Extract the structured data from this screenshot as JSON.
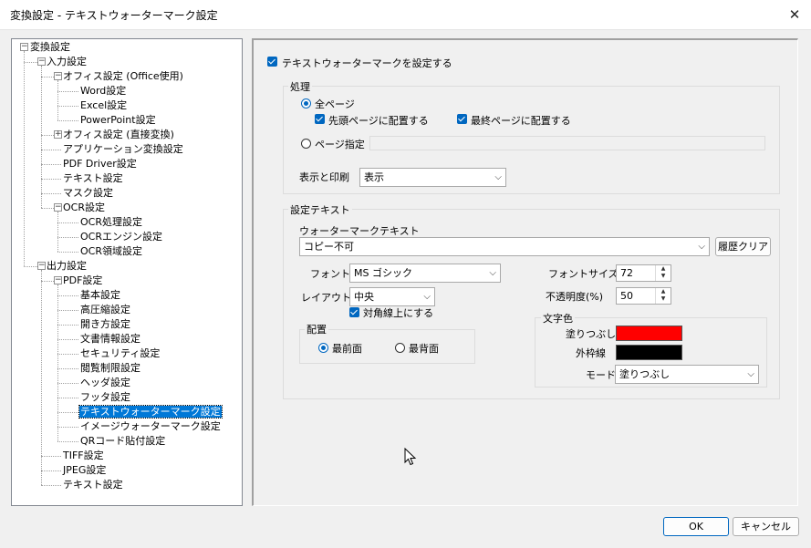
{
  "window": {
    "title": "変換設定 - テキストウォーターマーク設定"
  },
  "tree": {
    "nodes": [
      {
        "label": "変換設定",
        "level": 0,
        "expander": "minus"
      },
      {
        "label": "入力設定",
        "level": 1,
        "expander": "minus"
      },
      {
        "label": "オフィス設定 (Office使用)",
        "level": 2,
        "expander": "minus"
      },
      {
        "label": "Word設定",
        "level": 3
      },
      {
        "label": "Excel設定",
        "level": 3
      },
      {
        "label": "PowerPoint設定",
        "level": 3
      },
      {
        "label": "オフィス設定 (直接変換)",
        "level": 2,
        "expander": "plus"
      },
      {
        "label": "アプリケーション変換設定",
        "level": 2
      },
      {
        "label": "PDF Driver設定",
        "level": 2
      },
      {
        "label": "テキスト設定",
        "level": 2
      },
      {
        "label": "マスク設定",
        "level": 2
      },
      {
        "label": "OCR設定",
        "level": 2,
        "expander": "minus"
      },
      {
        "label": "OCR処理設定",
        "level": 3
      },
      {
        "label": "OCRエンジン設定",
        "level": 3
      },
      {
        "label": "OCR領域設定",
        "level": 3
      },
      {
        "label": "出力設定",
        "level": 1,
        "expander": "minus"
      },
      {
        "label": "PDF設定",
        "level": 2,
        "expander": "minus"
      },
      {
        "label": "基本設定",
        "level": 3
      },
      {
        "label": "高圧縮設定",
        "level": 3
      },
      {
        "label": "開き方設定",
        "level": 3
      },
      {
        "label": "文書情報設定",
        "level": 3
      },
      {
        "label": "セキュリティ設定",
        "level": 3
      },
      {
        "label": "閲覧制限設定",
        "level": 3
      },
      {
        "label": "ヘッダ設定",
        "level": 3
      },
      {
        "label": "フッタ設定",
        "level": 3
      },
      {
        "label": "テキストウォーターマーク設定",
        "level": 3,
        "selected": true
      },
      {
        "label": "イメージウォーターマーク設定",
        "level": 3
      },
      {
        "label": "QRコード貼付設定",
        "level": 3
      },
      {
        "label": "TIFF設定",
        "level": 2
      },
      {
        "label": "JPEG設定",
        "level": 2
      },
      {
        "label": "テキスト設定",
        "level": 2
      }
    ]
  },
  "panel": {
    "enable_checkbox": {
      "label": "テキストウォーターマークを設定する",
      "checked": true
    },
    "processing": {
      "group_label": "処理",
      "all_pages": {
        "label": "全ページ",
        "selected": true
      },
      "first_page": {
        "label": "先頭ページに配置する",
        "checked": true
      },
      "last_page": {
        "label": "最終ページに配置する",
        "checked": true
      },
      "page_spec": {
        "label": "ページ指定",
        "selected": false
      },
      "display_print_label": "表示と印刷",
      "display_print_value": "表示"
    },
    "text_settings": {
      "group_label": "設定テキスト",
      "watermark_text_label": "ウォーターマークテキスト",
      "watermark_text_value": "コピー不可",
      "history_clear_button": "履歴クリア",
      "font_label": "フォント",
      "font_value": "MS ゴシック",
      "layout_label": "レイアウト",
      "layout_value": "中央",
      "diagonal": {
        "label": "対角線上にする",
        "checked": true
      },
      "placement": {
        "group_label": "配置",
        "front": {
          "label": "最前面",
          "selected": true
        },
        "back": {
          "label": "最背面",
          "selected": false
        }
      },
      "font_size_label": "フォントサイズ",
      "font_size_value": "72",
      "opacity_label": "不透明度(%)",
      "opacity_value": "50",
      "text_color": {
        "group_label": "文字色",
        "fill_label": "塗りつぶし",
        "fill_color": "#ff0000",
        "outline_label": "外枠線",
        "outline_color": "#000000",
        "mode_label": "モード",
        "mode_value": "塗りつぶし"
      }
    }
  },
  "footer": {
    "ok_button": "OK",
    "cancel_button": "キャンセル"
  },
  "colors": {
    "accent": "#0067c0",
    "selection": "#0078d7"
  }
}
